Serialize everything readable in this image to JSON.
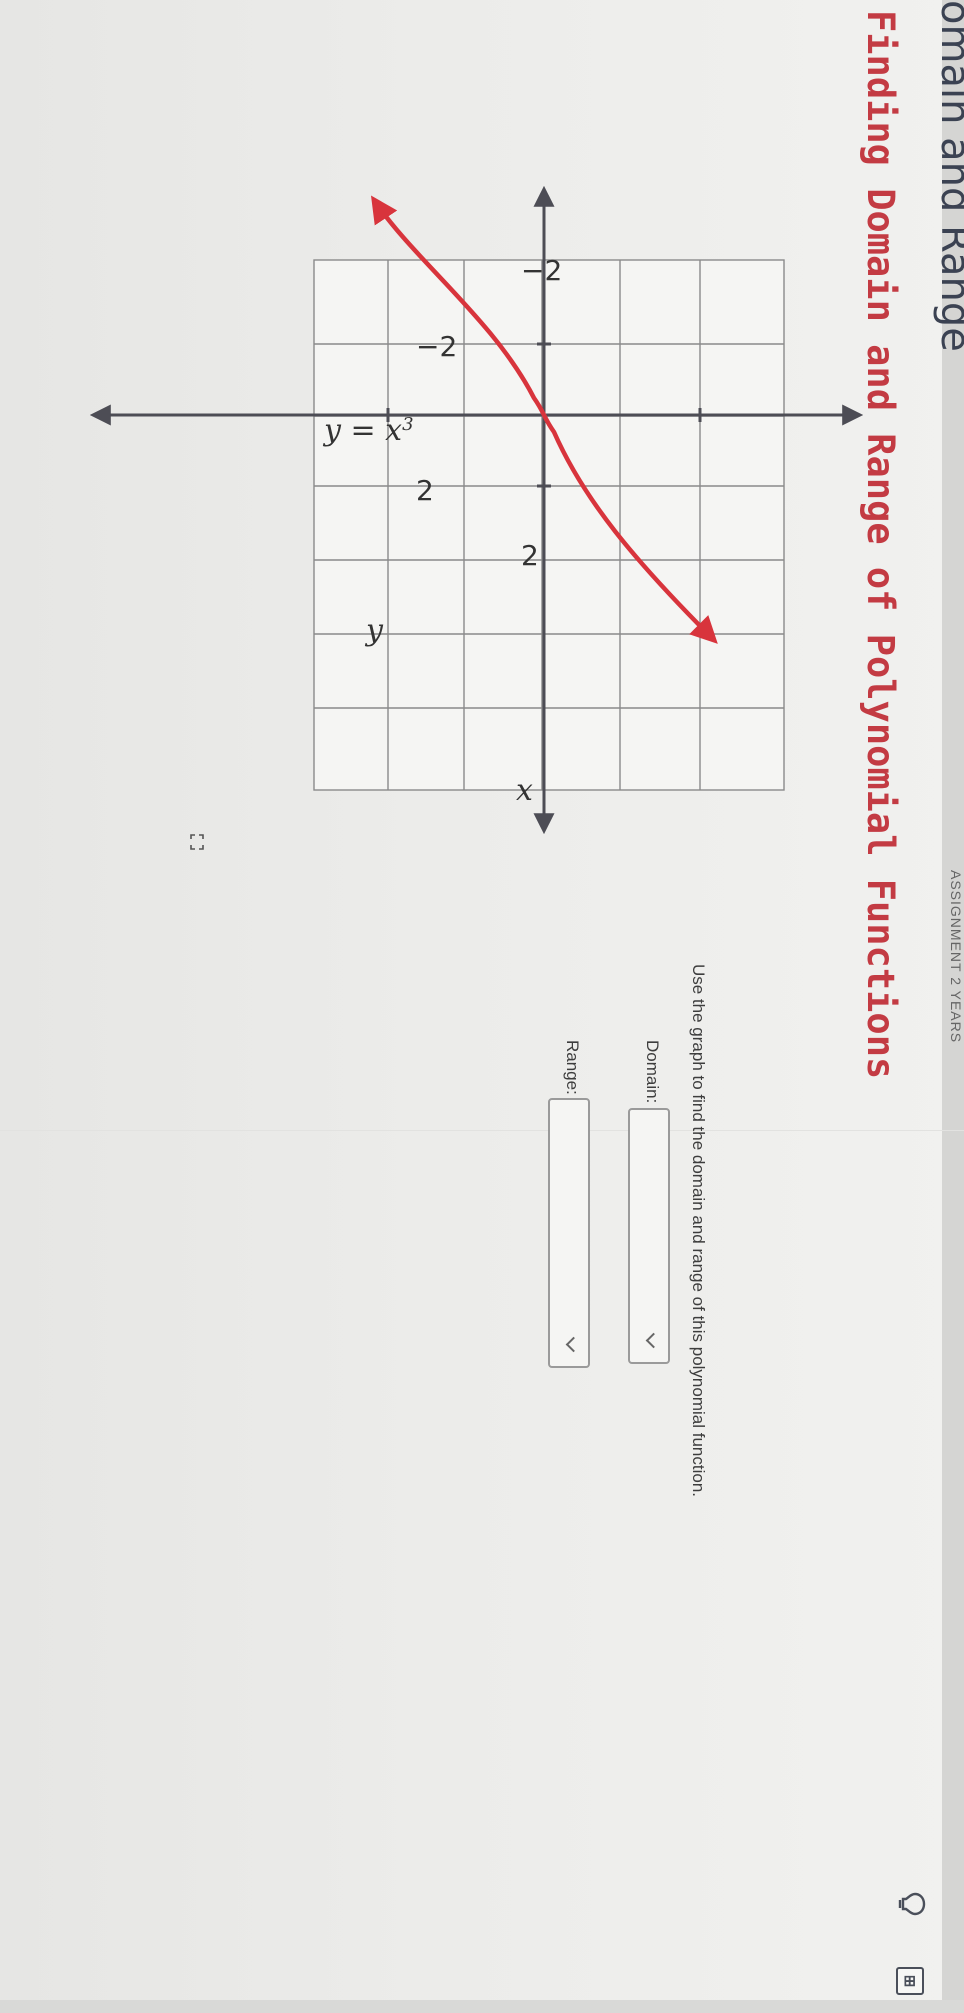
{
  "header": {
    "breadcrumb_title": "omain and Range",
    "top_right_label": "ASSIGNMENT 2 YEARS",
    "heading": "Finding Domain and Range of Polynomial Functions"
  },
  "toolbar": {
    "lightbulb_icon": "lightbulb-icon",
    "calculator_icon": "calculator-icon",
    "calculator_glyph": "⊞"
  },
  "graph": {
    "y_axis_label": "y",
    "x_axis_label": "x",
    "equation_prefix": "y = x",
    "equation_exponent": "3",
    "tick_y_pos": "2",
    "tick_y_neg": "−2",
    "tick_x_pos": "2",
    "tick_x_neg": "−2",
    "curve_color": "#d8343c",
    "axis_color": "#4d4d55"
  },
  "question": {
    "prompt": "Use the graph to find the domain and range of this polynomial function.",
    "domain_label": "Domain:",
    "range_label": "Range:",
    "domain_value": "",
    "range_value": ""
  },
  "footer": {
    "expand_icon": "expand-icon"
  }
}
